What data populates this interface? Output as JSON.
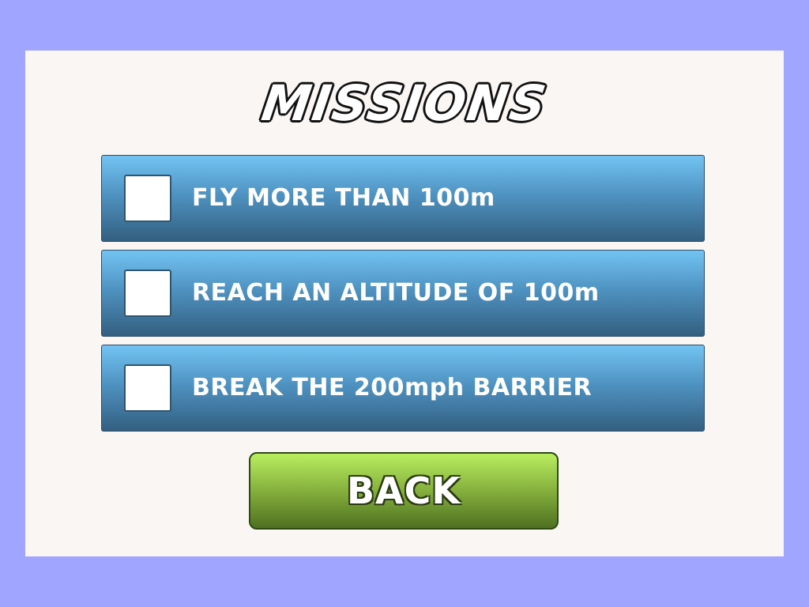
{
  "title": "MISSIONS",
  "missions": [
    {
      "label": "FLY MORE THAN 100m",
      "completed": false
    },
    {
      "label": "REACH AN ALTITUDE OF 100m",
      "completed": false
    },
    {
      "label": "BREAK THE 200mph BARRIER",
      "completed": false
    }
  ],
  "back_button": {
    "label": "BACK"
  },
  "colors": {
    "background": "#a0a6ff",
    "panel": "#faf6f4",
    "mission_top": "#72c4f2",
    "mission_bottom": "#335f80",
    "back_top": "#b9ee60",
    "back_bottom": "#4f7121"
  }
}
